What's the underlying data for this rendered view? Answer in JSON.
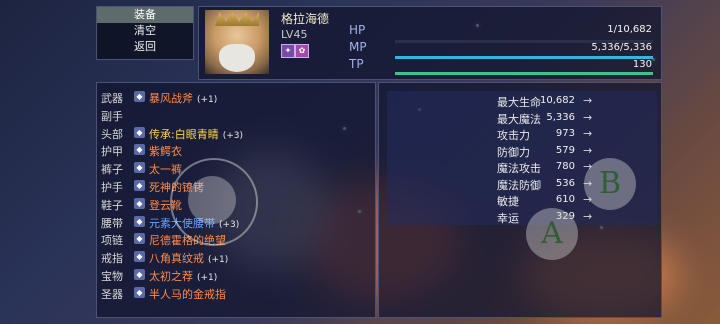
{
  "menu": {
    "items": [
      "装备",
      "清空",
      "返回"
    ],
    "selected": 0
  },
  "character": {
    "name": "格拉海德",
    "level": "LV45",
    "status_icons": [
      "buff-icon-1",
      "buff-icon-2"
    ]
  },
  "stats_bars": {
    "hp": {
      "label": "HP",
      "value": "1/10,682",
      "fraction": 0.0001,
      "color": "#3a3f66"
    },
    "mp": {
      "label": "MP",
      "value": "5,336/5,336",
      "fraction": 1.0,
      "color": "#35b2e8"
    },
    "tp": {
      "label": "TP",
      "value": "130",
      "fraction": 1.0,
      "color": "#41c28a"
    }
  },
  "equipment": [
    {
      "slot": "武器",
      "item": "暴风战斧",
      "plus": "(+1)",
      "icon": "axe-icon",
      "color": "#ff8a4a"
    },
    {
      "slot": "副手",
      "item": "",
      "plus": "",
      "icon": "",
      "color": "#ff8a4a"
    },
    {
      "slot": "头部",
      "item": "传承:白眼青睛",
      "plus": "(+3)",
      "icon": "helmet-icon",
      "color": "#ffd54a"
    },
    {
      "slot": "护甲",
      "item": "紫鳄衣",
      "plus": "",
      "icon": "armor-icon",
      "color": "#ff8a4a"
    },
    {
      "slot": "裤子",
      "item": "太一裤",
      "plus": "",
      "icon": "pants-icon",
      "color": "#ff8a4a"
    },
    {
      "slot": "护手",
      "item": "死神的镣铐",
      "plus": "",
      "icon": "gauntlet-icon",
      "color": "#ff8a4a"
    },
    {
      "slot": "鞋子",
      "item": "登云靴",
      "plus": "",
      "icon": "boots-icon",
      "color": "#ff8a4a"
    },
    {
      "slot": "腰带",
      "item": "元素大使腰带",
      "plus": "(+3)",
      "icon": "belt-icon",
      "color": "#6aa0ff"
    },
    {
      "slot": "项链",
      "item": "尼德霍格的绝望",
      "plus": "",
      "icon": "necklace-icon",
      "color": "#ff8a4a"
    },
    {
      "slot": "戒指",
      "item": "八角真纹戒",
      "plus": "(+1)",
      "icon": "ring-icon",
      "color": "#ff8a4a"
    },
    {
      "slot": "宝物",
      "item": "太初之荐",
      "plus": "(+1)",
      "icon": "treasure-icon",
      "color": "#ff8a4a"
    },
    {
      "slot": "圣器",
      "item": "半人马的金戒指",
      "plus": "",
      "icon": "relic-icon",
      "color": "#ff8a4a"
    }
  ],
  "attributes": [
    {
      "label": "最大生命",
      "value": "10,682",
      "arrow": "→"
    },
    {
      "label": "最大魔法",
      "value": "5,336",
      "arrow": "→"
    },
    {
      "label": "攻击力",
      "value": "973",
      "arrow": "→"
    },
    {
      "label": "防御力",
      "value": "579",
      "arrow": "→"
    },
    {
      "label": "魔法攻击",
      "value": "780",
      "arrow": "→"
    },
    {
      "label": "魔法防御",
      "value": "536",
      "arrow": "→"
    },
    {
      "label": "敏捷",
      "value": "610",
      "arrow": "→"
    },
    {
      "label": "幸运",
      "value": "329",
      "arrow": "→"
    }
  ],
  "controls": {
    "a_label": "A",
    "b_label": "B"
  }
}
